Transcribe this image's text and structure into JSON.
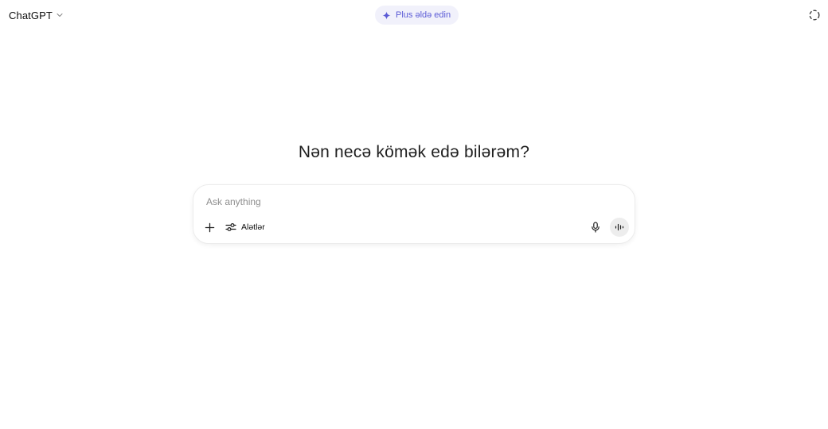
{
  "header": {
    "model_name": "ChatGPT",
    "model_chevron_icon": "chevron-down-icon",
    "upgrade_label": "Plus əldə edin",
    "upgrade_icon": "sparkle-icon",
    "temporary_chat_icon": "temporary-chat-icon",
    "accent_color": "#5b5bd6"
  },
  "main": {
    "headline": "Nən necə kömək edə bilərəm?"
  },
  "composer": {
    "placeholder": "Ask anything",
    "value": "",
    "add_icon": "plus-icon",
    "tools_icon": "sliders-icon",
    "tools_label": "Alətlər",
    "mic_icon": "microphone-icon",
    "voice_icon": "voice-waveform-icon"
  }
}
